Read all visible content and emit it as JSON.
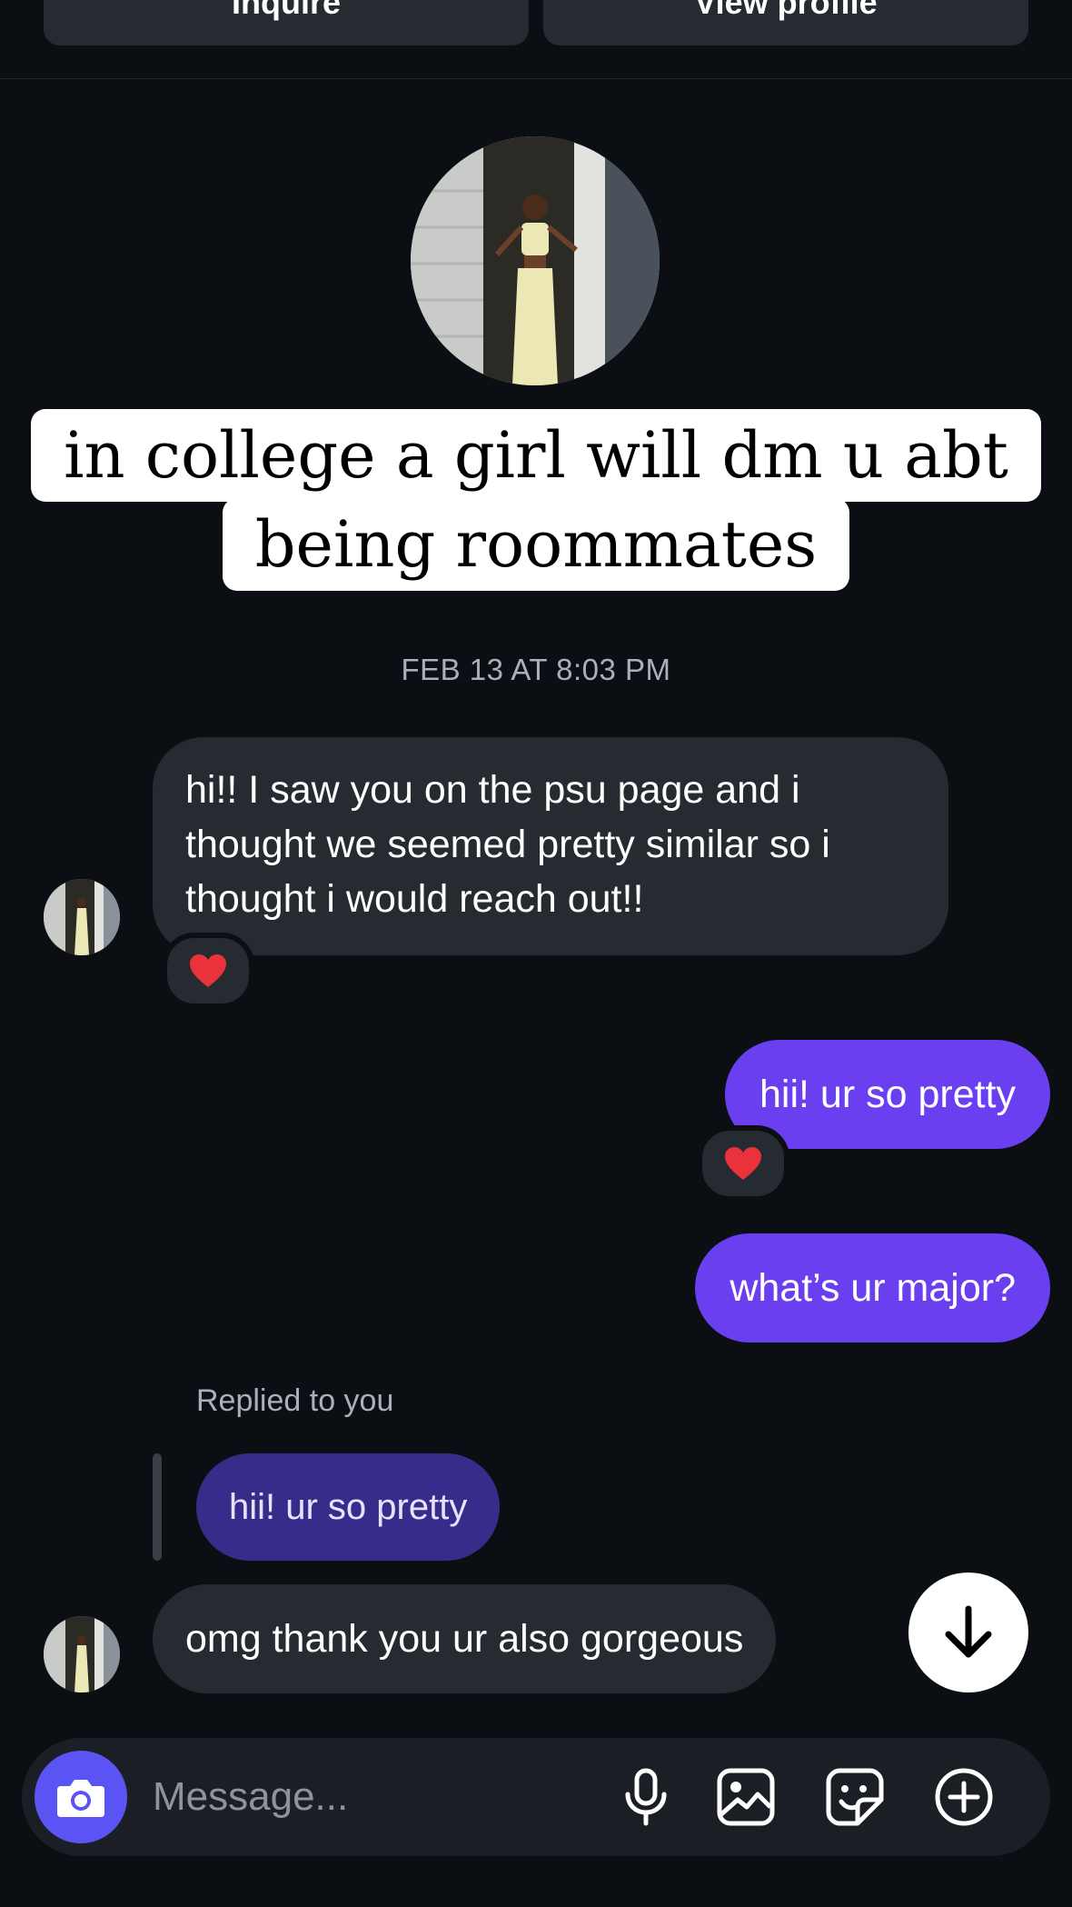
{
  "header": {
    "inquire_label": "Inquire",
    "view_profile_label": "View profile"
  },
  "story": {
    "caption_line1": "in college a girl will dm u abt",
    "caption_line2": "being roommates"
  },
  "conversation": {
    "timestamp": "FEB 13 AT 8:03 PM",
    "messages": [
      {
        "from": "them",
        "text": "hi!! I saw you on the psu page and i thought we seemed pretty similar so i thought i would reach out!!",
        "reaction": "heart"
      },
      {
        "from": "me",
        "text": "hii! ur so pretty",
        "reaction": "heart"
      },
      {
        "from": "me",
        "text": "what’s ur major?"
      },
      {
        "from": "them",
        "text": "omg thank you ur also gorgeous",
        "replied_label": "Replied to you",
        "quoted_text": "hii! ur so pretty"
      }
    ]
  },
  "composer": {
    "placeholder": "Message...",
    "icons": [
      "camera-icon",
      "microphone-icon",
      "gallery-icon",
      "sticker-icon",
      "plus-icon"
    ]
  },
  "colors": {
    "background": "#0b0f14",
    "incoming_bubble": "#262a31",
    "outgoing_bubble": "#6a3ff0",
    "quoted_bubble": "#382c8a",
    "camera_button": "#5b54f5"
  }
}
